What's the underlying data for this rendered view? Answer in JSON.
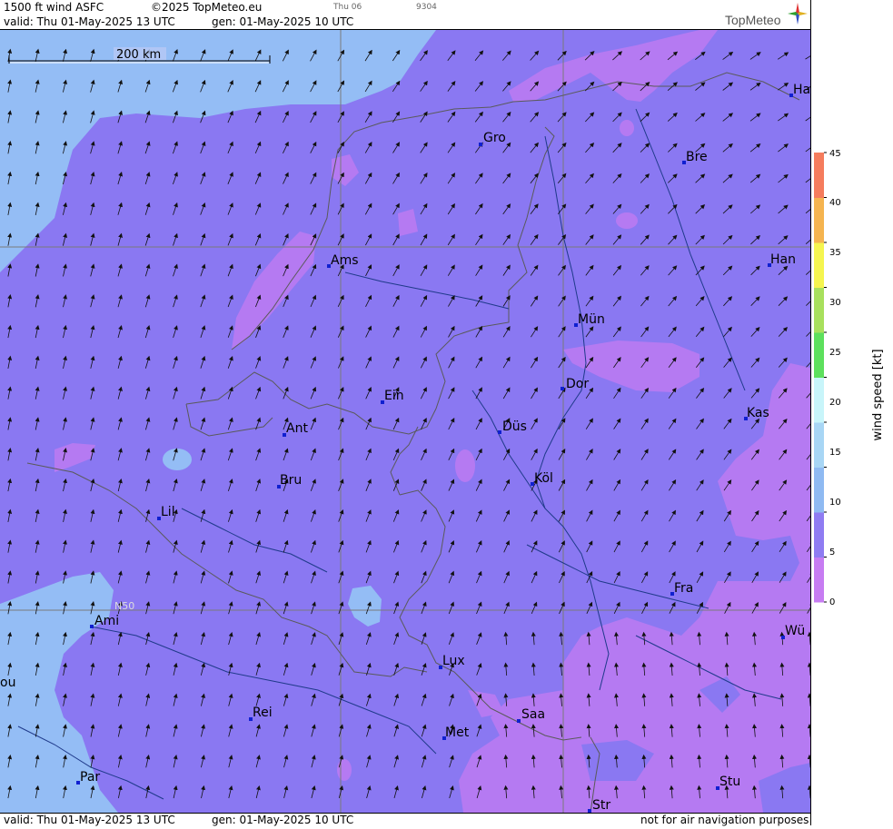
{
  "header": {
    "title": "1500 ft wind ASFC",
    "copyright": "©2025 TopMeteo.eu",
    "small_day": "Thu 06",
    "small_code": "9304",
    "valid": "valid:  Thu  01-May-2025  13 UTC",
    "gen": "gen: 01-May-2025 10 UTC",
    "logo": "TopMeteo"
  },
  "footer": {
    "valid": "valid:  Thu  01-May-2025  13 UTC",
    "gen": "gen: 01-May-2025 10 UTC",
    "disclaimer": "not for air navigation purposes"
  },
  "scale": {
    "label": "200 km"
  },
  "latitude_label": "N50",
  "cities": [
    {
      "name": "Gro"
    },
    {
      "name": "Bre"
    },
    {
      "name": "Ha"
    },
    {
      "name": "Han"
    },
    {
      "name": "Ams"
    },
    {
      "name": "Mün"
    },
    {
      "name": "Dor"
    },
    {
      "name": "Ein"
    },
    {
      "name": "Kas"
    },
    {
      "name": "Düs"
    },
    {
      "name": "Ant"
    },
    {
      "name": "Bru"
    },
    {
      "name": "Köl"
    },
    {
      "name": "Lil"
    },
    {
      "name": "Fra"
    },
    {
      "name": "Ami"
    },
    {
      "name": "Wü"
    },
    {
      "name": "Lux"
    },
    {
      "name": "ou"
    },
    {
      "name": "Rei"
    },
    {
      "name": "Saa"
    },
    {
      "name": "Met"
    },
    {
      "name": "Par"
    },
    {
      "name": "Stu"
    },
    {
      "name": "Str"
    }
  ],
  "legend": {
    "title": "wind speed [kt]",
    "ticks": [
      "0",
      "5",
      "10",
      "15",
      "20",
      "25",
      "30",
      "35",
      "40",
      "45"
    ],
    "colors": [
      "#c77cf2",
      "#8f7cf2",
      "#8fbaf2",
      "#a8d6f5",
      "#c8f5fa",
      "#5de05d",
      "#a8e05d",
      "#f5f550",
      "#f5b450",
      "#f57c5d"
    ]
  },
  "colors": {
    "wind_0_5": "#b57af2",
    "wind_5_10": "#8a78f2",
    "wind_10_15": "#94bdf5"
  }
}
